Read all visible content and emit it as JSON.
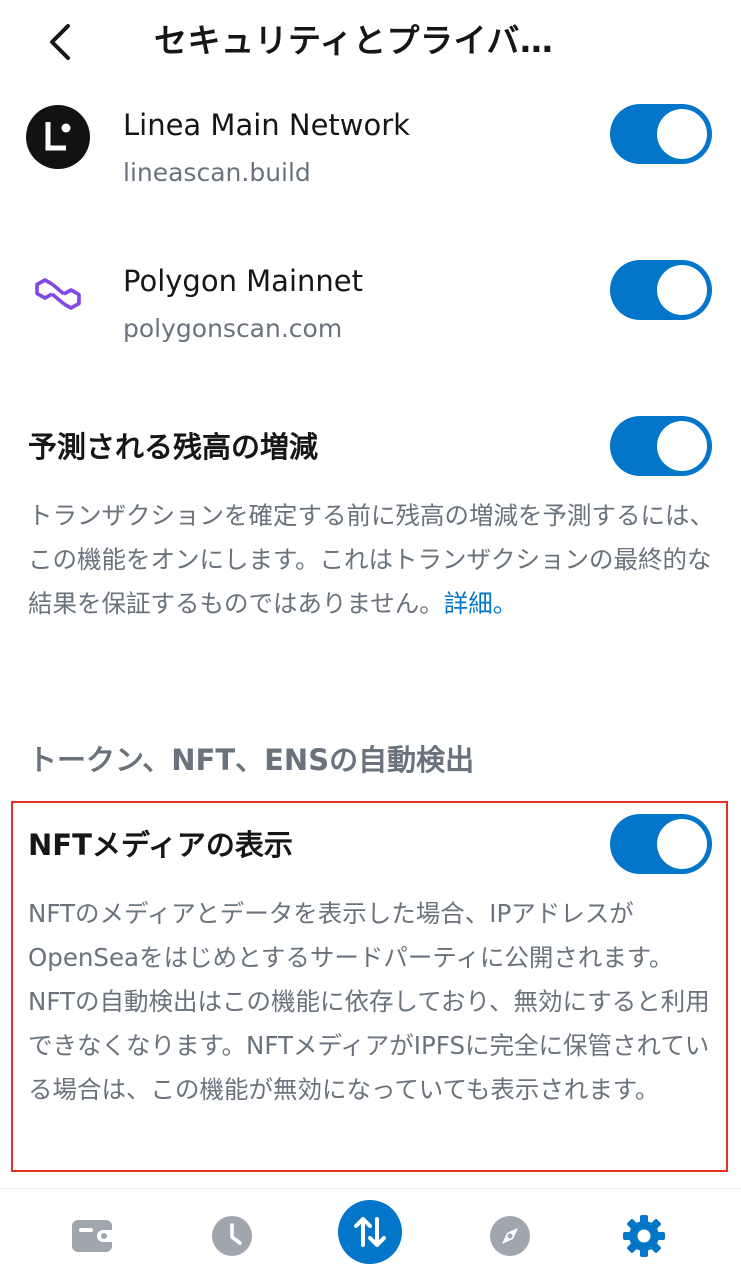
{
  "header": {
    "title": "セキュリティとプライバ…",
    "back_icon": "chevron-left-icon"
  },
  "networks": [
    {
      "name": "Linea Main Network",
      "url": "lineascan.build",
      "icon": "linea-logo-icon",
      "enabled": true
    },
    {
      "name": "Polygon Mainnet",
      "url": "polygonscan.com",
      "icon": "polygon-logo-icon",
      "enabled": true
    }
  ],
  "balance_changes": {
    "title": "予測される残高の増減",
    "description": "トランザクションを確定する前に残高の増減を予測するには、この機能をオンにします。これはトランザクションの最終的な結果を保証するものではありません。",
    "link": "詳細。",
    "enabled": true
  },
  "section": {
    "heading": "トークン、NFT、ENSの自動検出"
  },
  "nft_media": {
    "title": "NFTメディアの表示",
    "description": "NFTのメディアとデータを表示した場合、IPアドレスがOpenSeaをはじめとするサードパーティに公開されます。NFTの自動検出はこの機能に依存しており、無効にすると利用できなくなります。NFTメディアがIPFSに完全に保管されている場合は、この機能が無効になっていても表示されます。",
    "enabled": true
  },
  "tabbar": {
    "items": [
      "wallet-icon",
      "activity-clock-icon",
      "swap-bridge-icon",
      "explore-compass-icon",
      "settings-gear-icon"
    ],
    "active": "settings-gear-icon"
  },
  "colors": {
    "accent": "#0376c9",
    "highlight_border": "#e5311f",
    "muted_text": "#6a737d",
    "inactive_icon": "#9fa6ae"
  }
}
